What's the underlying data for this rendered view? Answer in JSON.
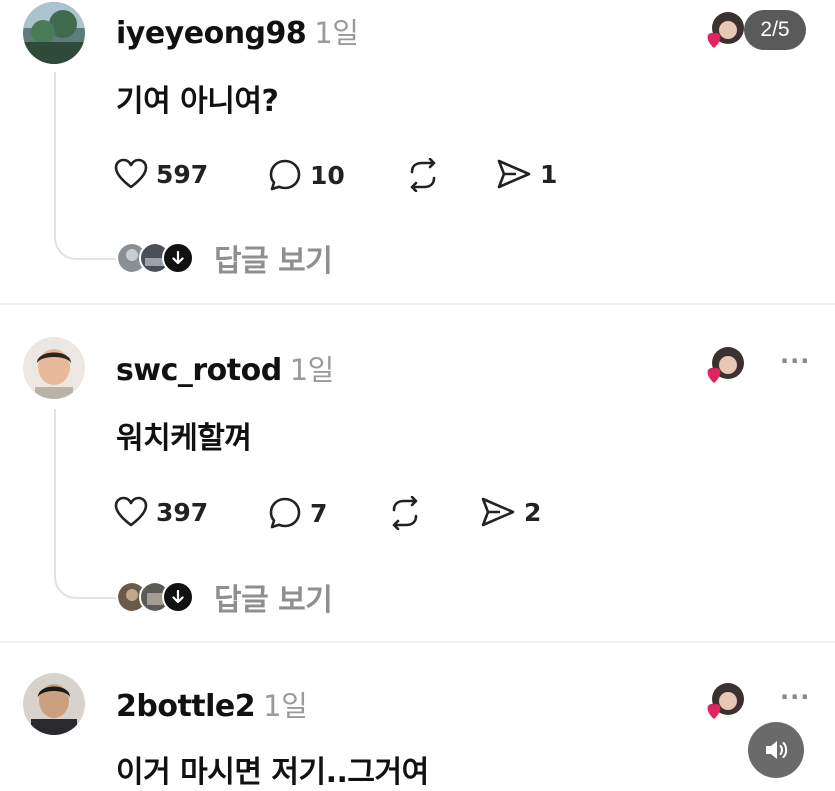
{
  "posts": [
    {
      "username": "iyeyeong98",
      "time": "1일",
      "text": "기여 아니여?",
      "likes": "597",
      "comments": "10",
      "shares": "1",
      "view_replies": "답글 보기"
    },
    {
      "username": "swc_rotod",
      "time": "1일",
      "text": "워치케할껴",
      "likes": "397",
      "comments": "7",
      "shares": "2",
      "view_replies": "답글 보기"
    },
    {
      "username": "2bottle2",
      "time": "1일",
      "text": "이거 마시면 저기..그거여"
    }
  ],
  "overlay": {
    "page_indicator": "2/5"
  },
  "more_menu_label": "···",
  "icons": [
    "heart-icon",
    "comment-icon",
    "repost-icon",
    "send-icon",
    "chevron-down-icon",
    "speaker-icon"
  ],
  "colors": {
    "text": "#111111",
    "muted": "#9a9a9a",
    "like_heart": "#e0245e",
    "badge_bg": "#5a5a5a"
  }
}
